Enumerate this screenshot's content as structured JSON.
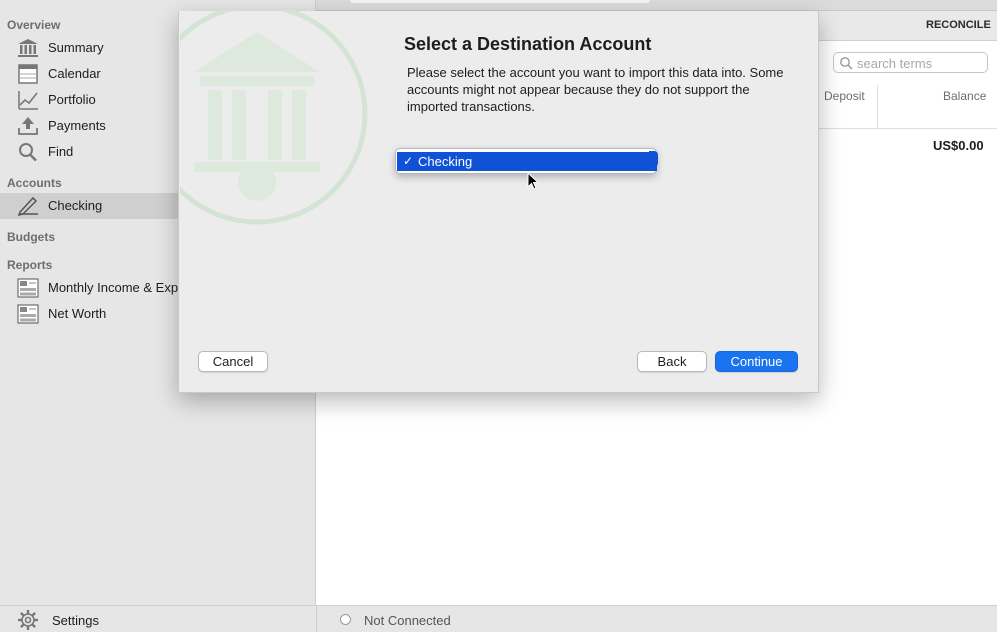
{
  "sidebar": {
    "sections": {
      "overview": "Overview",
      "accounts": "Accounts",
      "budgets": "Budgets",
      "reports": "Reports"
    },
    "items": [
      {
        "label": "Summary",
        "icon": "bank-icon"
      },
      {
        "label": "Calendar",
        "icon": "calendar-icon"
      },
      {
        "label": "Portfolio",
        "icon": "chart-icon"
      },
      {
        "label": "Payments",
        "icon": "upload-tray-icon"
      },
      {
        "label": "Find",
        "icon": "magnifier-icon"
      },
      {
        "label": "Checking",
        "icon": "pencil-icon",
        "selected": true
      },
      {
        "label": "Monthly Income & Expenses",
        "icon": "report-icon"
      },
      {
        "label": "Net Worth",
        "icon": "report-icon"
      }
    ],
    "settings_label": "Settings"
  },
  "main": {
    "reconcile_label": "RECONCILE",
    "search_placeholder": "search terms",
    "columns": {
      "deposit": "Deposit",
      "balance": "Balance"
    },
    "balance_value": "US$0.00"
  },
  "status": {
    "connection": "Not Connected"
  },
  "dialog": {
    "title": "Select a Destination Account",
    "description": "Please select the account you want to import this data into. Some accounts might not appear because they do not support the imported transactions.",
    "dropdown": {
      "selected": "Checking",
      "check": "✓"
    },
    "buttons": {
      "cancel": "Cancel",
      "back": "Back",
      "continue": "Continue"
    }
  },
  "colors": {
    "accent_blue": "#1a74f0",
    "menu_highlight": "#0f52d8",
    "sidebar_bg": "#e6e6e6",
    "selected_row": "#cfcfcf"
  }
}
